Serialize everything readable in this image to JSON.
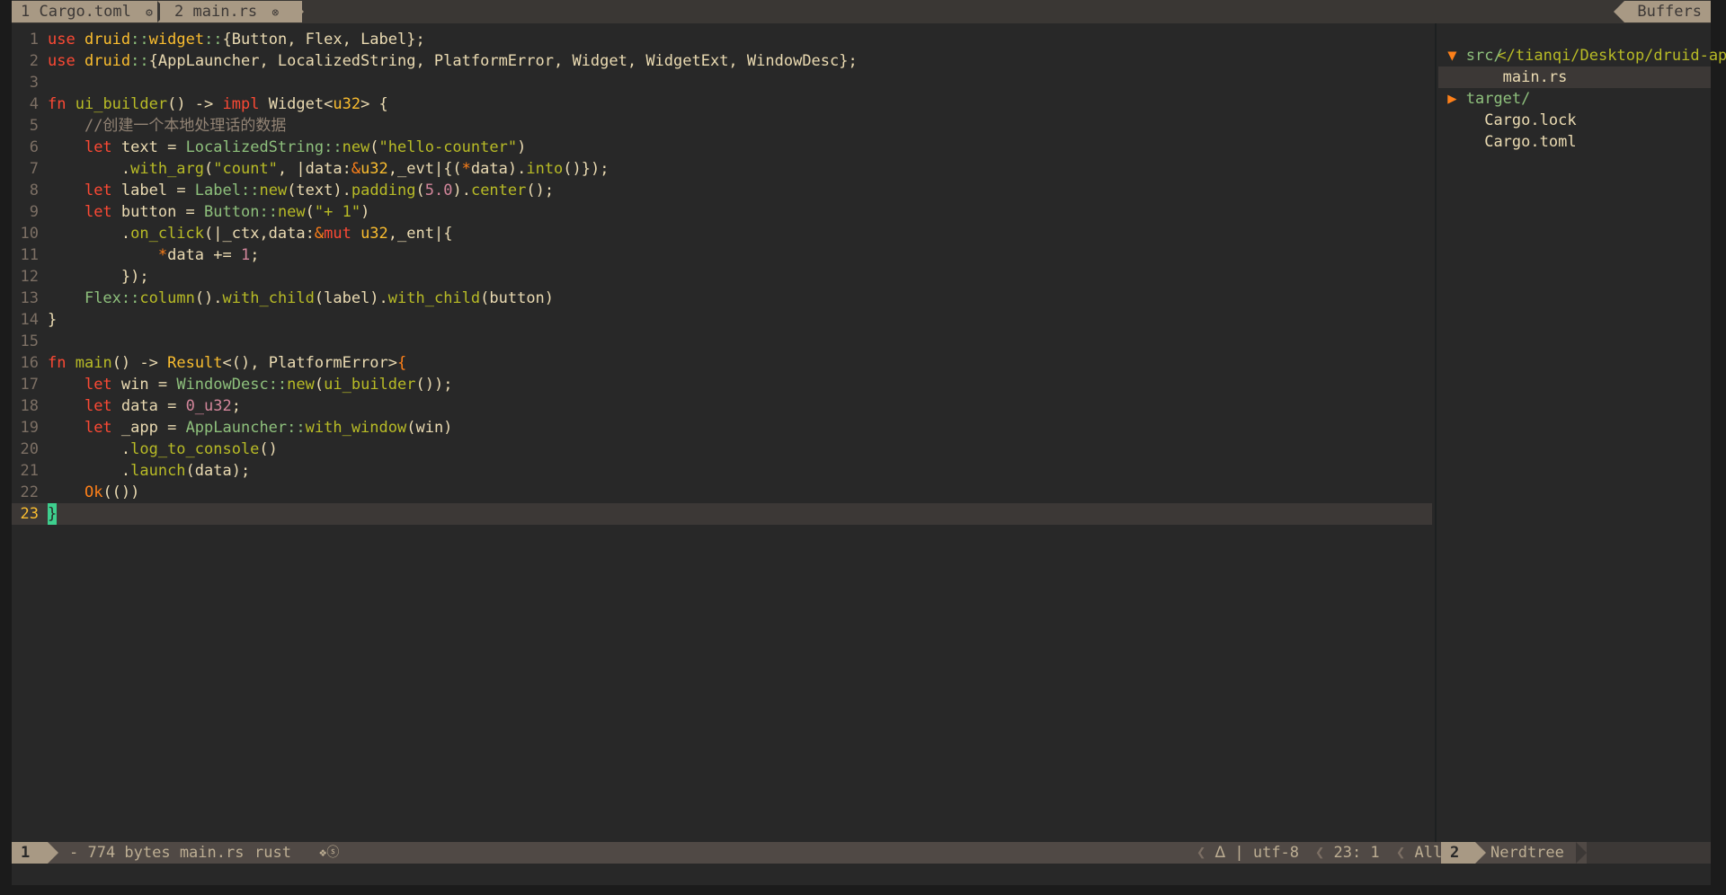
{
  "tabline": {
    "tabs": [
      {
        "number": "1",
        "name": "Cargo.toml",
        "icon": "gear-icon",
        "glyph": "⚙"
      },
      {
        "number": "2",
        "name": "main.rs",
        "icon": "modified-icon",
        "glyph": "⊗"
      }
    ],
    "right_label": "Buffers"
  },
  "editor": {
    "language": "rust",
    "cursor": {
      "line": 23,
      "col": 1
    },
    "lines": [
      {
        "n": "1",
        "tokens": [
          [
            "kw",
            "use"
          ],
          [
            "pu",
            " "
          ],
          [
            "ty",
            "druid"
          ],
          [
            "ns",
            "::"
          ],
          [
            "ty",
            "widget"
          ],
          [
            "ns",
            "::"
          ],
          [
            "pu",
            "{Button, Flex, Label};"
          ]
        ]
      },
      {
        "n": "2",
        "tokens": [
          [
            "kw",
            "use"
          ],
          [
            "pu",
            " "
          ],
          [
            "ty",
            "druid"
          ],
          [
            "ns",
            "::"
          ],
          [
            "pu",
            "{AppLauncher, LocalizedString, PlatformError, Widget, WidgetExt, WindowDesc};"
          ]
        ]
      },
      {
        "n": "3",
        "tokens": []
      },
      {
        "n": "4",
        "tokens": [
          [
            "kw",
            "fn"
          ],
          [
            "pu",
            " "
          ],
          [
            "fn",
            "ui_builder"
          ],
          [
            "pu",
            "() -> "
          ],
          [
            "kw",
            "impl"
          ],
          [
            "pu",
            " Widget<"
          ],
          [
            "ty",
            "u32"
          ],
          [
            "pu",
            "> {"
          ]
        ]
      },
      {
        "n": "5",
        "tokens": [
          [
            "pu",
            "    "
          ],
          [
            "cm",
            "//创建一个本地处理话的数据"
          ]
        ]
      },
      {
        "n": "6",
        "tokens": [
          [
            "pu",
            "    "
          ],
          [
            "kw",
            "let"
          ],
          [
            "pu",
            " text = "
          ],
          [
            "ns",
            "LocalizedString"
          ],
          [
            "ns",
            "::"
          ],
          [
            "fn",
            "new"
          ],
          [
            "pu",
            "("
          ],
          [
            "st",
            "\"hello-counter\""
          ],
          [
            "pu",
            ")"
          ]
        ]
      },
      {
        "n": "7",
        "tokens": [
          [
            "pu",
            "        ."
          ],
          [
            "fn",
            "with_arg"
          ],
          [
            "pu",
            "("
          ],
          [
            "st",
            "\"count\""
          ],
          [
            "pu",
            ", |data:"
          ],
          [
            "op",
            "&"
          ],
          [
            "ty",
            "u32"
          ],
          [
            "pu",
            ",_evt|{("
          ],
          [
            "op",
            "*"
          ],
          [
            "pu",
            "data)."
          ],
          [
            "fn",
            "into"
          ],
          [
            "pu",
            "()});"
          ]
        ]
      },
      {
        "n": "8",
        "tokens": [
          [
            "pu",
            "    "
          ],
          [
            "kw",
            "let"
          ],
          [
            "pu",
            " label = "
          ],
          [
            "ns",
            "Label"
          ],
          [
            "ns",
            "::"
          ],
          [
            "fn",
            "new"
          ],
          [
            "pu",
            "(text)."
          ],
          [
            "fn",
            "padding"
          ],
          [
            "pu",
            "("
          ],
          [
            "nm",
            "5.0"
          ],
          [
            "pu",
            ")."
          ],
          [
            "fn",
            "center"
          ],
          [
            "pu",
            "();"
          ]
        ]
      },
      {
        "n": "9",
        "tokens": [
          [
            "pu",
            "    "
          ],
          [
            "kw",
            "let"
          ],
          [
            "pu",
            " button = "
          ],
          [
            "ns",
            "Button"
          ],
          [
            "ns",
            "::"
          ],
          [
            "fn",
            "new"
          ],
          [
            "pu",
            "("
          ],
          [
            "st",
            "\"+ 1\""
          ],
          [
            "pu",
            ")"
          ]
        ]
      },
      {
        "n": "10",
        "tokens": [
          [
            "pu",
            "        ."
          ],
          [
            "fn",
            "on_click"
          ],
          [
            "pu",
            "(|_ctx,data:"
          ],
          [
            "op",
            "&"
          ],
          [
            "kw",
            "mut"
          ],
          [
            "pu",
            " "
          ],
          [
            "ty",
            "u32"
          ],
          [
            "pu",
            ",_ent|{"
          ]
        ]
      },
      {
        "n": "11",
        "tokens": [
          [
            "pu",
            "            "
          ],
          [
            "op",
            "*"
          ],
          [
            "pu",
            "data += "
          ],
          [
            "nm",
            "1"
          ],
          [
            "pu",
            ";"
          ]
        ]
      },
      {
        "n": "12",
        "tokens": [
          [
            "pu",
            "        });"
          ]
        ]
      },
      {
        "n": "13",
        "tokens": [
          [
            "pu",
            "    "
          ],
          [
            "ns",
            "Flex"
          ],
          [
            "ns",
            "::"
          ],
          [
            "fn",
            "column"
          ],
          [
            "pu",
            "()."
          ],
          [
            "fn",
            "with_child"
          ],
          [
            "pu",
            "(label)."
          ],
          [
            "fn",
            "with_child"
          ],
          [
            "pu",
            "(button)"
          ]
        ]
      },
      {
        "n": "14",
        "tokens": [
          [
            "pu",
            "}"
          ]
        ]
      },
      {
        "n": "15",
        "tokens": []
      },
      {
        "n": "16",
        "tokens": [
          [
            "kw",
            "fn"
          ],
          [
            "pu",
            " "
          ],
          [
            "fn",
            "main"
          ],
          [
            "pu",
            "() -> "
          ],
          [
            "ty",
            "Result"
          ],
          [
            "pu",
            "<(), PlatformError>"
          ],
          [
            "op",
            "{"
          ]
        ]
      },
      {
        "n": "17",
        "tokens": [
          [
            "pu",
            "    "
          ],
          [
            "kw",
            "let"
          ],
          [
            "pu",
            " win = "
          ],
          [
            "ns",
            "WindowDesc"
          ],
          [
            "ns",
            "::"
          ],
          [
            "fn",
            "new"
          ],
          [
            "pu",
            "("
          ],
          [
            "fn",
            "ui_builder"
          ],
          [
            "pu",
            "());"
          ]
        ]
      },
      {
        "n": "18",
        "tokens": [
          [
            "pu",
            "    "
          ],
          [
            "kw",
            "let"
          ],
          [
            "pu",
            " data = "
          ],
          [
            "nm",
            "0_u32"
          ],
          [
            "pu",
            ";"
          ]
        ]
      },
      {
        "n": "19",
        "tokens": [
          [
            "pu",
            "    "
          ],
          [
            "kw",
            "let"
          ],
          [
            "pu",
            " _app = "
          ],
          [
            "ns",
            "AppLauncher"
          ],
          [
            "ns",
            "::"
          ],
          [
            "fn",
            "with_window"
          ],
          [
            "pu",
            "(win)"
          ]
        ]
      },
      {
        "n": "20",
        "tokens": [
          [
            "pu",
            "        ."
          ],
          [
            "fn",
            "log_to_console"
          ],
          [
            "pu",
            "()"
          ]
        ]
      },
      {
        "n": "21",
        "tokens": [
          [
            "pu",
            "        ."
          ],
          [
            "fn",
            "launch"
          ],
          [
            "pu",
            "(data);"
          ]
        ]
      },
      {
        "n": "22",
        "tokens": [
          [
            "pu",
            "    "
          ],
          [
            "op",
            "Ok"
          ],
          [
            "pu",
            "(())"
          ]
        ]
      },
      {
        "n": "23",
        "tokens": [
          [
            "cursor",
            "}"
          ]
        ]
      }
    ]
  },
  "nerdtree": {
    "path": "</tianqi/Desktop/druid-app/",
    "items": [
      {
        "arrow": "▼ ",
        "name": "src/",
        "kind": "dir",
        "indent": ""
      },
      {
        "arrow": "",
        "name": "main.rs",
        "kind": "file",
        "indent": "    ",
        "selected": true
      },
      {
        "arrow": "▶ ",
        "name": "target/",
        "kind": "dir",
        "indent": ""
      },
      {
        "arrow": "",
        "name": "Cargo.lock",
        "kind": "file",
        "indent": "  "
      },
      {
        "arrow": "",
        "name": "Cargo.toml",
        "kind": "file",
        "indent": "  "
      }
    ]
  },
  "statusline": {
    "mode_number": "1",
    "file_info": "- 774 bytes main.rs",
    "filetype": "rust",
    "icons": "❖ⓢ",
    "lock_icon": "ᐃ",
    "encoding": "utf-8",
    "position": "23:  1",
    "percent": "All",
    "nt_number": "2",
    "nt_name": "Nerdtree"
  }
}
